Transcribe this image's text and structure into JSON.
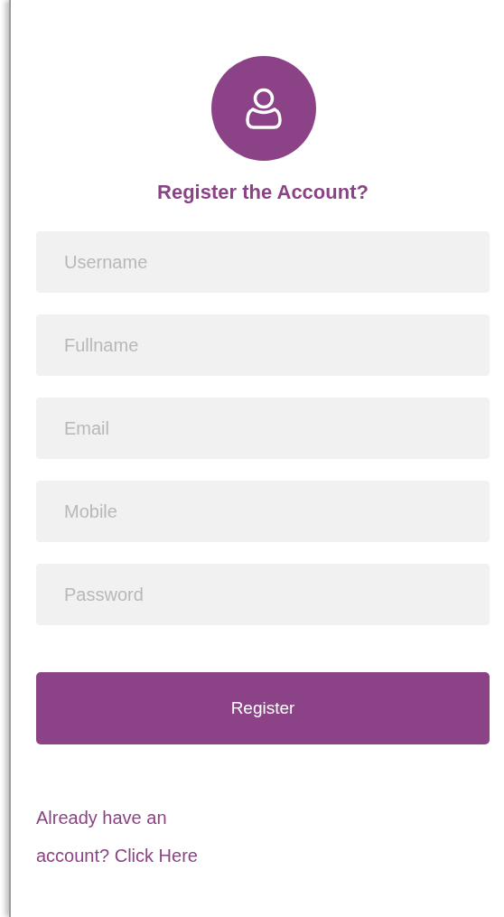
{
  "title": "Register the Account?",
  "fields": [
    {
      "placeholder": "Username"
    },
    {
      "placeholder": "Fullname"
    },
    {
      "placeholder": "Email"
    },
    {
      "placeholder": "Mobile"
    },
    {
      "placeholder": "Password"
    }
  ],
  "button": "Register",
  "login_link": "Already have an account? Click Here"
}
